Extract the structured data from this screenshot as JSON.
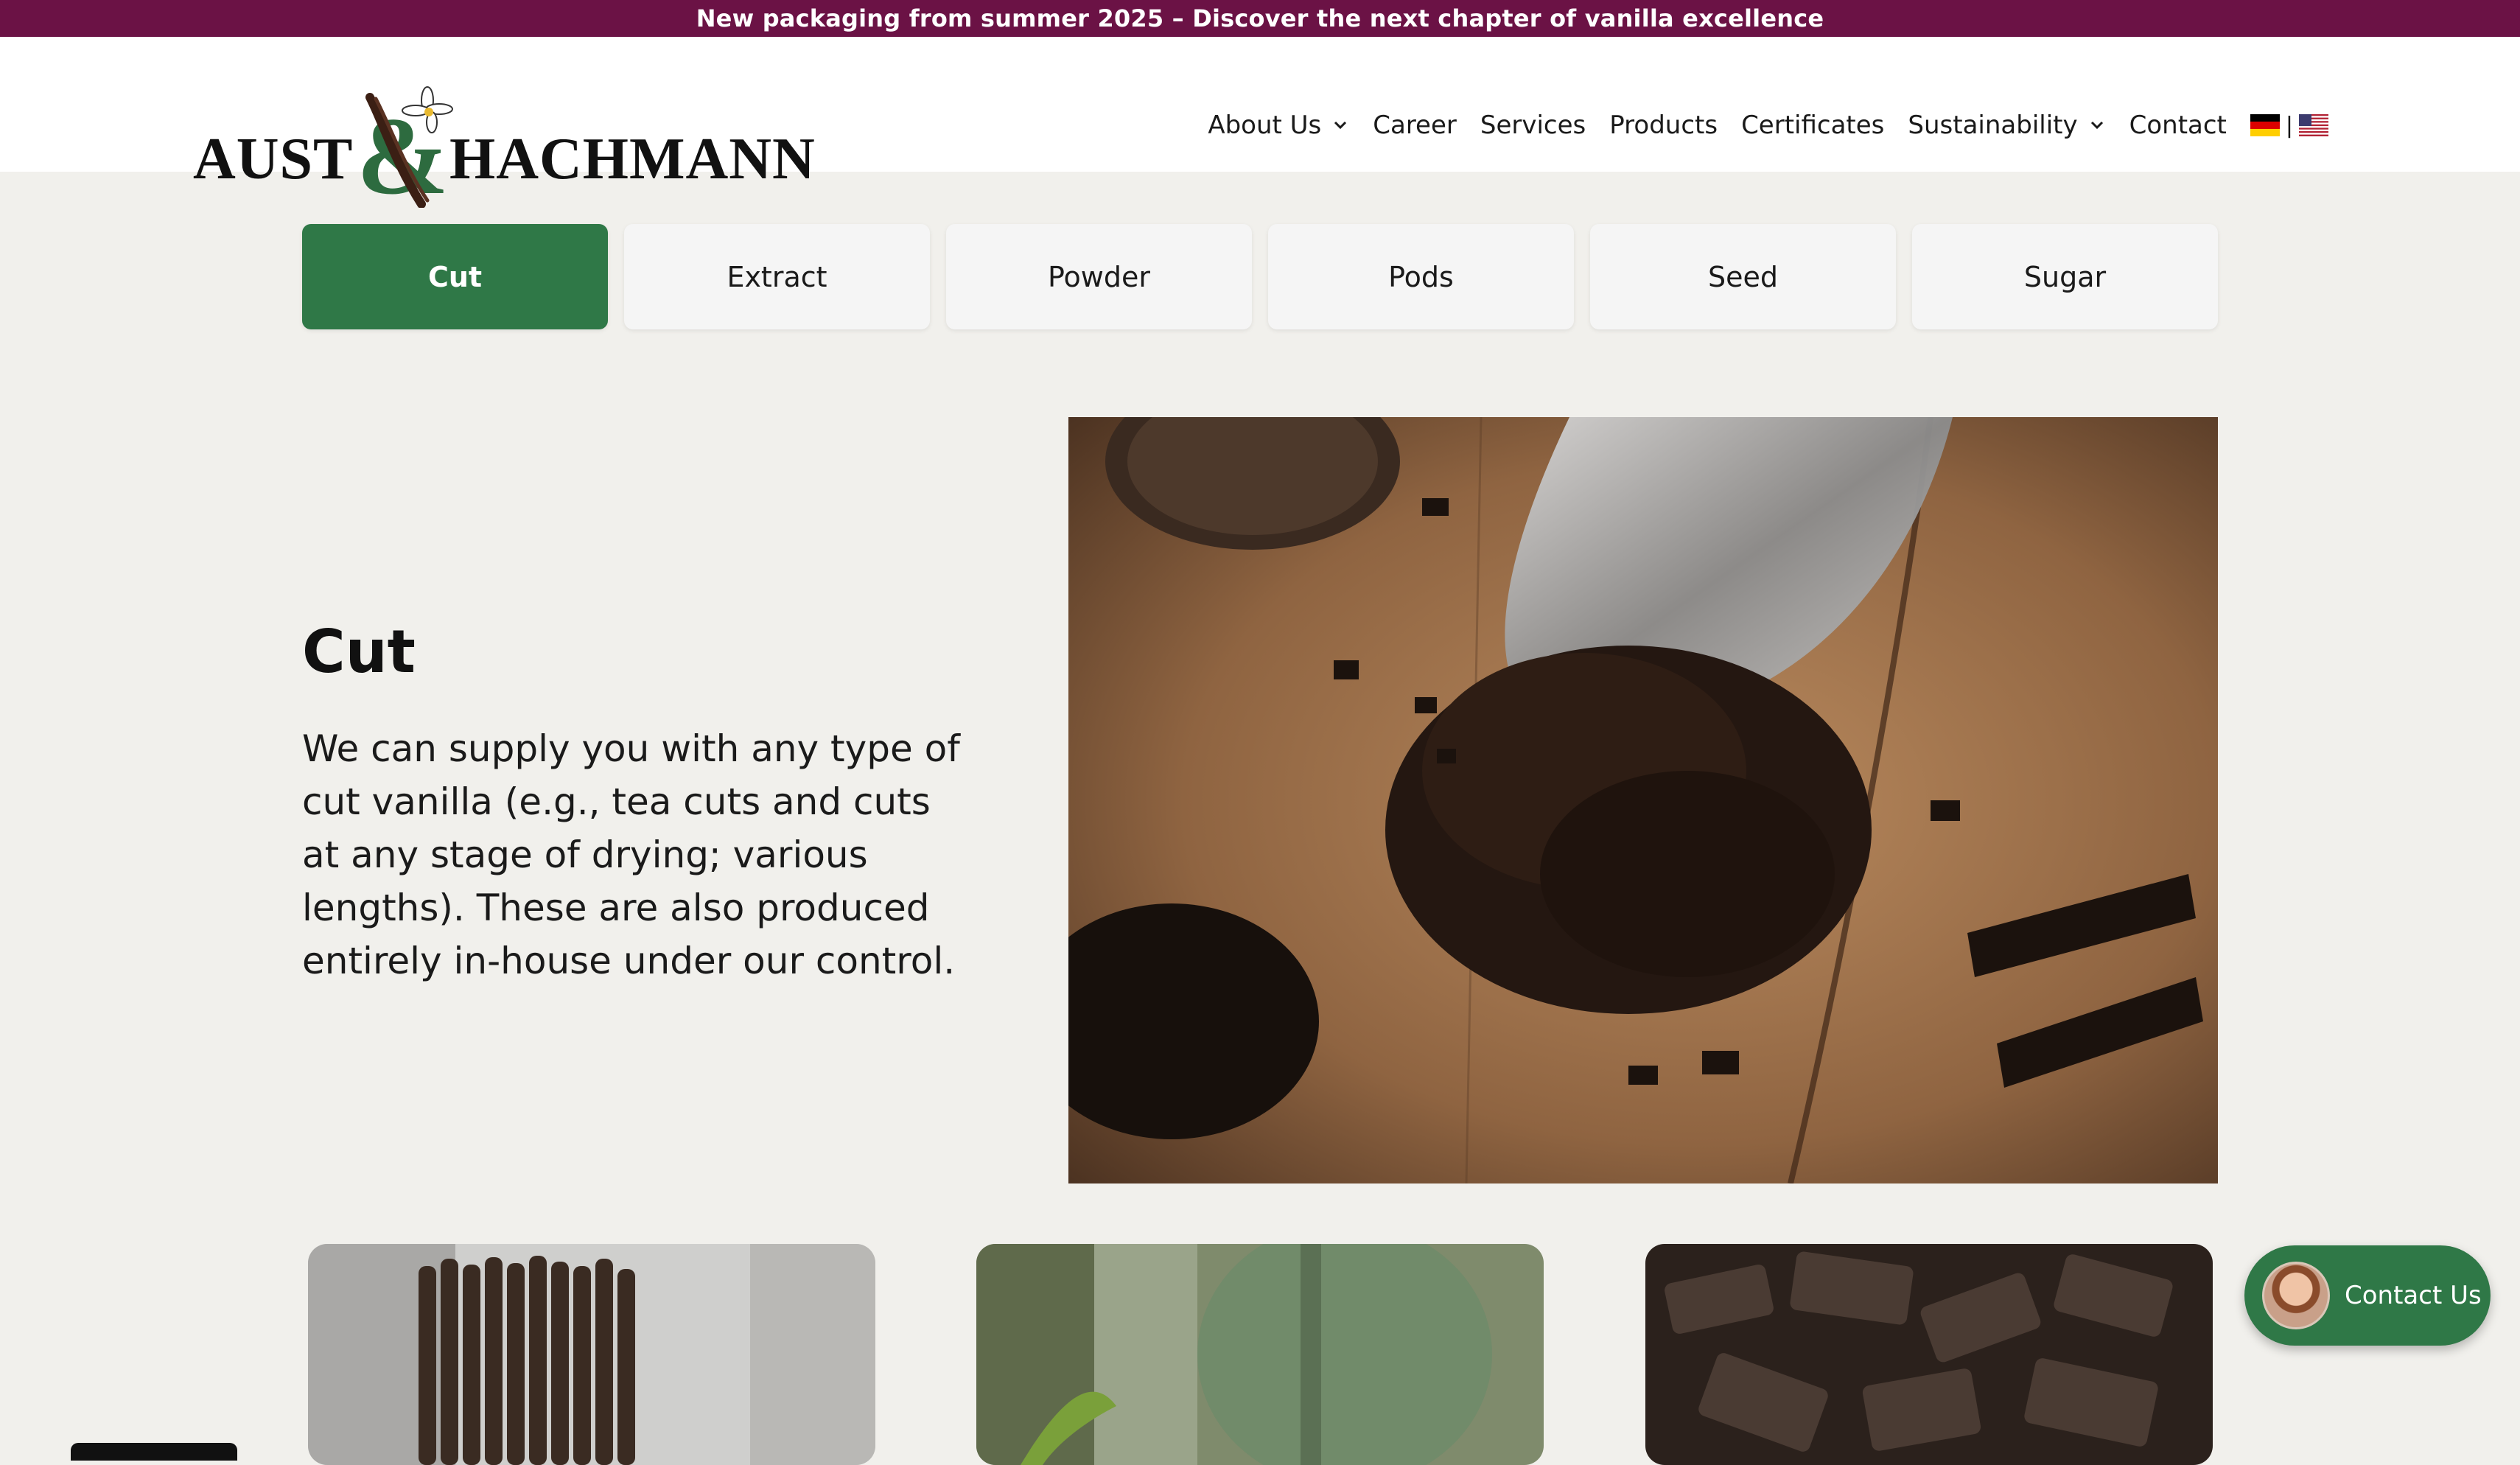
{
  "announcement": {
    "text": "New packaging from summer 2025 – Discover the next chapter of vanilla excellence"
  },
  "logo": {
    "left": "AUST",
    "ampersand": "&",
    "right": "HACHMANN"
  },
  "nav": {
    "items": [
      {
        "label": "About Us",
        "has_dropdown": true
      },
      {
        "label": "Career",
        "has_dropdown": false
      },
      {
        "label": "Services",
        "has_dropdown": false
      },
      {
        "label": "Products",
        "has_dropdown": false
      },
      {
        "label": "Certificates",
        "has_dropdown": false
      },
      {
        "label": "Sustainability",
        "has_dropdown": true
      },
      {
        "label": "Contact",
        "has_dropdown": false
      }
    ],
    "language_separator": "|",
    "languages": [
      "german-flag-icon",
      "us-flag-icon"
    ]
  },
  "tabs": [
    {
      "label": "Cut",
      "active": true
    },
    {
      "label": "Extract",
      "active": false
    },
    {
      "label": "Powder",
      "active": false
    },
    {
      "label": "Pods",
      "active": false
    },
    {
      "label": "Seed",
      "active": false
    },
    {
      "label": "Sugar",
      "active": false
    }
  ],
  "section": {
    "title": "Cut",
    "description": "We can supply you with any type of cut vanilla (e.g., tea cuts and cuts at any stage of drying; various lengths). These are also produced entirely in-house under our control."
  },
  "contact_button": {
    "label": "Contact Us"
  },
  "colors": {
    "announcement_bg": "#6b1245",
    "accent_green": "#2f7847",
    "page_bg": "#f1f0ec"
  }
}
